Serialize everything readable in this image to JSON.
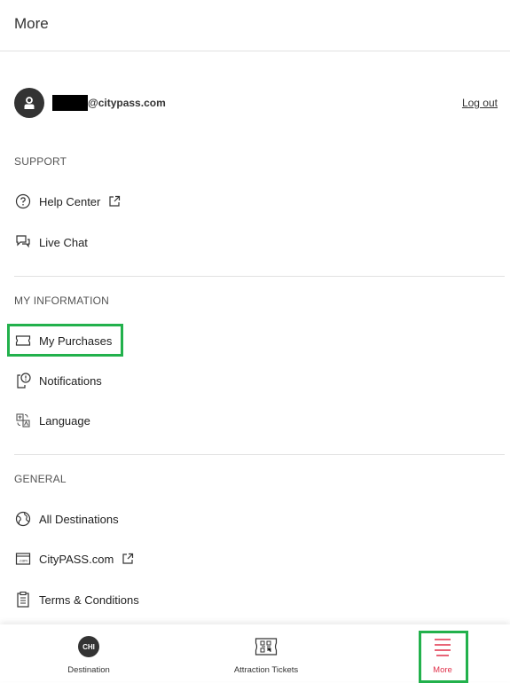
{
  "header": {
    "title": "More"
  },
  "account": {
    "email": "@citypass.com",
    "logout_label": "Log out",
    "avatar_icon": "user-icon"
  },
  "sections": [
    {
      "label": "SUPPORT",
      "items": [
        {
          "label": "Help Center",
          "icon": "help-circle-icon",
          "external": true
        },
        {
          "label": "Live Chat",
          "icon": "chat-bubbles-icon",
          "external": false
        }
      ]
    },
    {
      "label": "MY INFORMATION",
      "items": [
        {
          "label": "My Purchases",
          "icon": "ticket-icon",
          "external": false,
          "highlighted": true
        },
        {
          "label": "Notifications",
          "icon": "phone-notification-icon",
          "external": false
        },
        {
          "label": "Language",
          "icon": "translate-icon",
          "external": false
        }
      ]
    },
    {
      "label": "GENERAL",
      "items": [
        {
          "label": "All Destinations",
          "icon": "globe-icon",
          "external": false
        },
        {
          "label": "CityPASS.com",
          "icon": "website-icon",
          "external": true
        },
        {
          "label": "Terms & Conditions",
          "icon": "clipboard-icon",
          "external": false
        }
      ]
    }
  ],
  "tabbar": {
    "tabs": [
      {
        "label": "Destination",
        "badge": "CHI",
        "icon": "destination-badge-icon"
      },
      {
        "label": "Attraction Tickets",
        "icon": "qr-ticket-icon"
      },
      {
        "label": "More",
        "icon": "hamburger-menu-icon",
        "active": true,
        "highlighted": true
      }
    ]
  },
  "colors": {
    "accent": "#e0304a",
    "highlight": "#22b14c",
    "avatar_bg": "#333333"
  }
}
